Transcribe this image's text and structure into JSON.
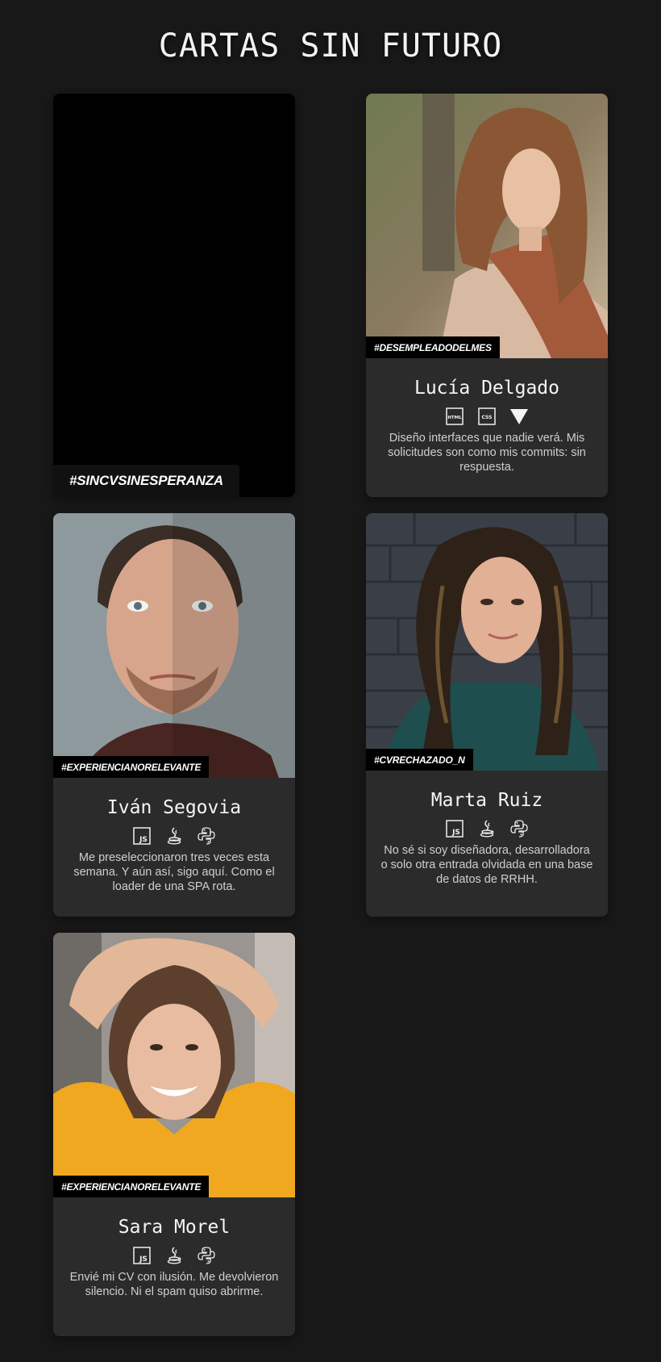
{
  "title": "CARTAS SIN FUTURO",
  "cards": [
    {
      "tag": "#SINCVSINESPERANZA",
      "blank": true
    },
    {
      "tag": "#DESEMPLEADODELMES",
      "name": "Lucía Delgado",
      "icons": [
        "html5-icon",
        "css3-icon",
        "vue-icon"
      ],
      "description": "Diseño interfaces que nadie verá. Mis solicitudes son como mis commits: sin respuesta."
    },
    {
      "tag": "#EXPERIENCIANORELEVANTE",
      "name": "Iván Segovia",
      "icons": [
        "javascript-icon",
        "java-icon",
        "python-icon"
      ],
      "description": "Me preseleccionaron tres veces esta semana. Y aún así, sigo aquí. Como el loader de una SPA rota."
    },
    {
      "tag": "#CVRECHAZADO_N",
      "name": "Marta Ruiz",
      "icons": [
        "javascript-icon",
        "java-icon",
        "python-icon"
      ],
      "description": "No sé si soy diseñadora, desarrolladora o solo otra entrada olvidada en una base de datos de RRHH."
    },
    {
      "tag": "#EXPERIENCIANORELEVANTE",
      "name": "Sara Morel",
      "icons": [
        "javascript-icon",
        "java-icon",
        "python-icon"
      ],
      "description": "Envié mi CV con ilusión. Me devolvieron silencio. Ni el spam quiso abrirme."
    }
  ],
  "colors": {
    "background": "#181818",
    "card": "#2b2b2b",
    "tag_bg": "#000000"
  }
}
